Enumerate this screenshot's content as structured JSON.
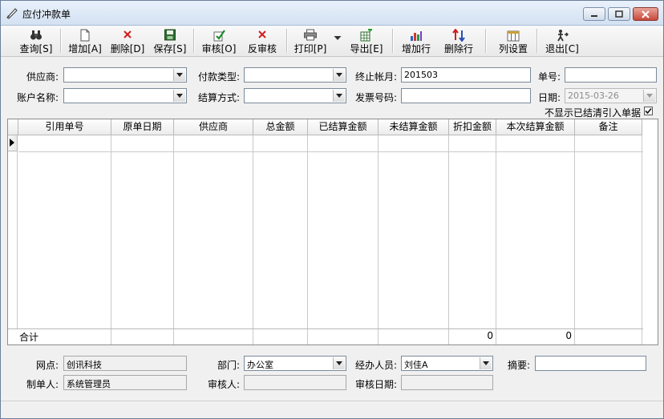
{
  "window": {
    "title": "应付冲款单"
  },
  "toolbar": {
    "query": "查询[S]",
    "add": "增加[A]",
    "delete": "删除[D]",
    "save": "保存[S]",
    "audit": "审核[O]",
    "unaudit": "反审核",
    "print": "打印[P]",
    "export": "导出[E]",
    "add_row": "增加行",
    "delete_row": "删除行",
    "column_settings": "列设置",
    "exit": "退出[C]"
  },
  "header_form": {
    "supplier_label": "供应商:",
    "supplier_value": "",
    "payment_type_label": "付款类型:",
    "payment_type_value": "",
    "end_period_label": "终止帐月:",
    "end_period_value": "201503",
    "doc_no_label": "单号:",
    "doc_no_value": "",
    "account_name_label": "账户名称:",
    "account_name_value": "",
    "settlement_method_label": "结算方式:",
    "settlement_method_value": "",
    "invoice_no_label": "发票号码:",
    "invoice_no_value": "",
    "date_label": "日期:",
    "date_value": "2015-03-26",
    "hide_settled_label": "不显示已结清引入单据",
    "hide_settled_checked": true
  },
  "grid": {
    "columns": [
      "引用单号",
      "原单日期",
      "供应商",
      "总金额",
      "已结算金额",
      "未结算金额",
      "折扣金额",
      "本次结算金额",
      "备注"
    ],
    "rows": [],
    "total_label": "合计",
    "total_discount": "0",
    "total_settlement": "0"
  },
  "footer_form": {
    "branch_label": "网点:",
    "branch_value": "创讯科技",
    "department_label": "部门:",
    "department_value": "办公室",
    "handler_label": "经办人员:",
    "handler_value": "刘佳A",
    "summary_label": "摘要:",
    "summary_value": "",
    "creator_label": "制单人:",
    "creator_value": "系统管理员",
    "auditor_label": "审核人:",
    "auditor_value": "",
    "audit_date_label": "审核日期:",
    "audit_date_value": ""
  },
  "colors": {
    "titlebar": "#dbe6f4",
    "close_button": "#c7493b",
    "window_bg": "#f0f0f0"
  },
  "icons": {
    "title": "pen-feather-icon",
    "query": "binoculars-icon",
    "add": "new-document-icon",
    "delete": "red-x-icon",
    "save": "floppy-disk-icon",
    "audit": "audit-stamp-icon",
    "unaudit": "red-x-icon",
    "print": "printer-icon",
    "export": "spreadsheet-export-icon",
    "add_row": "bar-chart-add-icon",
    "delete_row": "sort-arrows-icon",
    "column_settings": "column-settings-icon",
    "exit": "exit-door-icon"
  }
}
